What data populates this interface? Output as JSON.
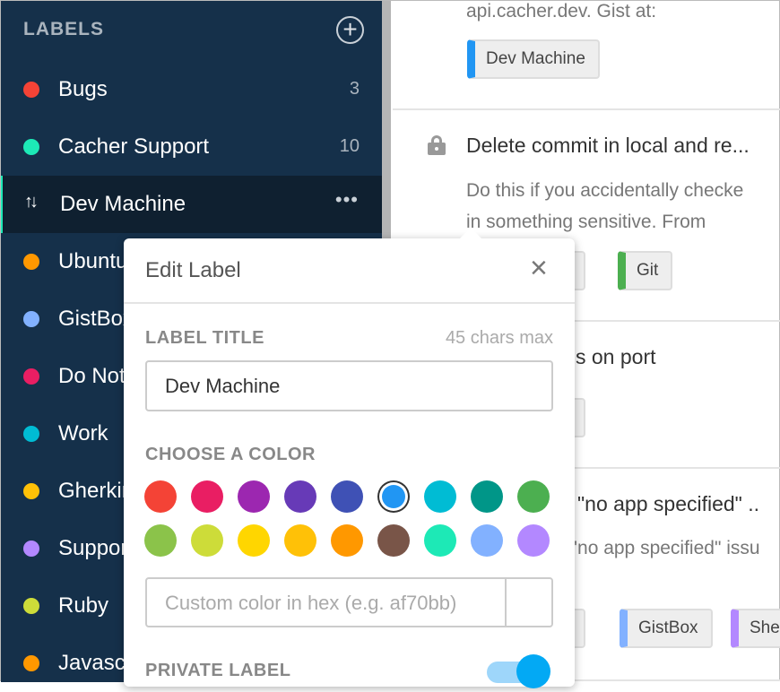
{
  "sidebar": {
    "heading": "LABELS",
    "add_icon": "plus-circle-icon",
    "items": [
      {
        "label": "Bugs",
        "count": "3",
        "color": "#f44336"
      },
      {
        "label": "Cacher Support",
        "count": "10",
        "color": "#1de9b6"
      },
      {
        "label": "Dev Machine",
        "selected": true,
        "icon": "sort-arrows-icon",
        "more": "•••"
      },
      {
        "label": "Ubuntu",
        "color": "#ff9800"
      },
      {
        "label": "GistBox",
        "color": "#82b1ff"
      },
      {
        "label": "Do Not",
        "color": "#e91e63"
      },
      {
        "label": "Work",
        "color": "#00bcd4"
      },
      {
        "label": "Gherkin",
        "color": "#ffc107"
      },
      {
        "label": "Support",
        "color": "#b388ff"
      },
      {
        "label": "Ruby",
        "color": "#cddc39"
      },
      {
        "label": "Javascript",
        "color": "#ff9800"
      }
    ]
  },
  "main": {
    "snippet1": {
      "desc": "api.cacher.dev. Gist at:",
      "tag": "Dev Machine"
    },
    "snippet2": {
      "title": "Delete commit in local and re...",
      "desc1": "Do this if you accidentally checke",
      "desc2": "in something sensitive. From",
      "tag_partial": "ne",
      "tag2": "Git"
    },
    "snippet3": {
      "title_partial": "s on port",
      "tag_partial": "ne"
    },
    "snippet4": {
      "title_partial": "\"no app specified\" ..",
      "desc_partial": "'no app specified\" issu",
      "tag_partial": "ne",
      "tag2": "GistBox",
      "tag3": "She"
    }
  },
  "popup": {
    "title": "Edit Label",
    "close": "×",
    "label_title": "LABEL TITLE",
    "max": "45 chars max",
    "title_value": "Dev Machine",
    "choose": "CHOOSE A COLOR",
    "colors": [
      "#f44336",
      "#e91e63",
      "#9c27b0",
      "#673ab7",
      "#3f51b5",
      "#2196f3",
      "#00bcd4",
      "#009688",
      "#4caf50",
      "#8bc34a",
      "#cddc39",
      "#ffd600",
      "#ffc107",
      "#ff9800",
      "#795548",
      "#1de9b6",
      "#82b1ff",
      "#b388ff"
    ],
    "selected_color": "#2196f3",
    "hex_placeholder": "Custom color in hex (e.g. af70bb)",
    "private": "PRIVATE LABEL",
    "private_on": true
  }
}
